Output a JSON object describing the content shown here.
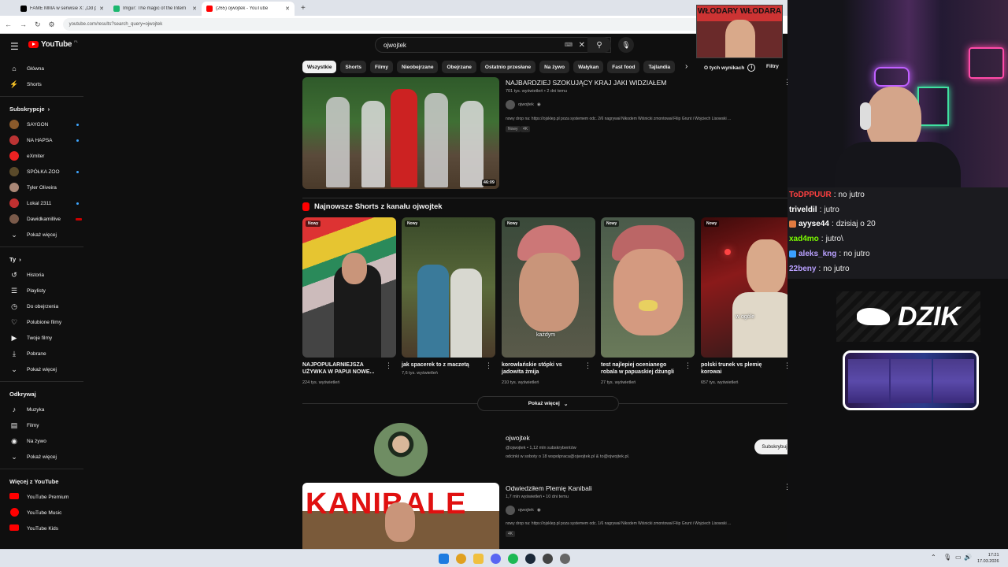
{
  "browser": {
    "tabs": [
      {
        "label": "FAME MMA w serwisie X: „Od p",
        "color": "#000000"
      },
      {
        "label": "Imgur: The magic of the Intern",
        "color": "#1bb76e"
      },
      {
        "label": "(265) ojwojtek - YouTube",
        "color": "#ff0000"
      }
    ],
    "new_tab": "+",
    "url": "youtube.com/results?search_query=ojwojtek"
  },
  "youtube": {
    "logo": "YouTube",
    "logo_region": "PL",
    "search_value": "ojwojtek",
    "sidebar": {
      "main": [
        {
          "label": "Główna",
          "icon": "home-icon"
        },
        {
          "label": "Shorts",
          "icon": "shorts-icon"
        }
      ],
      "subs_header": "Subskrypcje",
      "subs": [
        {
          "label": "SAYGON",
          "color": "#8b5a2b",
          "mark": "dot"
        },
        {
          "label": "NA HAPSA",
          "color": "#b33",
          "mark": "dot"
        },
        {
          "label": "eXmiter",
          "color": "#e22",
          "mark": ""
        },
        {
          "label": "SPÓŁKA ZOO",
          "color": "#5a4a2a",
          "mark": "dot"
        },
        {
          "label": "Tyler Oliveira",
          "color": "#aa8877",
          "mark": ""
        },
        {
          "label": "Lokal 2311",
          "color": "#c03030",
          "mark": "dot"
        },
        {
          "label": "Dawidkamillive",
          "color": "#7a5a4a",
          "mark": "live"
        }
      ],
      "subs_more": "Pokaż więcej",
      "you_header": "Ty",
      "you": [
        {
          "label": "Historia",
          "icon": "history-icon",
          "glyph": "↺"
        },
        {
          "label": "Playlisty",
          "icon": "playlist-icon",
          "glyph": "☰"
        },
        {
          "label": "Do obejrzenia",
          "icon": "watch-later-icon",
          "glyph": "◷"
        },
        {
          "label": "Polubione filmy",
          "icon": "like-icon",
          "glyph": "👍"
        },
        {
          "label": "Twoje filmy",
          "icon": "your-videos-icon",
          "glyph": "▶"
        },
        {
          "label": "Pobrane",
          "icon": "download-icon",
          "glyph": "⭳"
        },
        {
          "label": "Pokaż więcej",
          "icon": "chevron-down-icon",
          "glyph": "⌄"
        }
      ],
      "explore_header": "Odkrywaj",
      "explore": [
        {
          "label": "Muzyka",
          "icon": "music-icon",
          "glyph": "♪"
        },
        {
          "label": "Filmy",
          "icon": "film-icon",
          "glyph": "▤"
        },
        {
          "label": "Na żywo",
          "icon": "live-icon",
          "glyph": "◉"
        },
        {
          "label": "Pokaż więcej",
          "icon": "chevron-down-icon",
          "glyph": "⌄"
        }
      ],
      "more_header": "Więcej z YouTube",
      "more": [
        {
          "label": "YouTube Premium"
        },
        {
          "label": "YouTube Music"
        },
        {
          "label": "YouTube Kids"
        }
      ]
    },
    "chips": [
      "Wszystkie",
      "Shorts",
      "Filmy",
      "Nieobejrzane",
      "Obejrzane",
      "Ostatnio przesłane",
      "Na żywo",
      "Wałykan",
      "Fast food",
      "Tajlandia"
    ],
    "about": "O tych wynikach",
    "filters": "Filtry",
    "video1": {
      "title": "NAJBARDZIEJ SZOKUJĄCY KRAJ JAKI WIDZIAŁEM",
      "meta": "701 tys. wyświetleń • 2 dni temu",
      "channel": "ojwojtek",
      "desc": "nowy drop na: https://ojsklep.pl poza systemem odc. 2/6 nagrywał Nikodem Wiśnicki zmontował Filip Grunt i Wojciech Lisowski ...",
      "badges": [
        "Nowy",
        "4K"
      ],
      "duration": "46:09"
    },
    "shorts_header": "Najnowsze Shorts z kanału ojwojtek",
    "shorts": [
      {
        "new": "Nowy",
        "title": "NAJPOPULARNIEJSZA UŻYWKA W PAPUI NOWE...",
        "views": "224 tys. wyświetleń",
        "caption": ""
      },
      {
        "new": "Nowy",
        "title": "jak spacerek to z maczetą",
        "views": "7,6 tys. wyświetleń",
        "caption": ""
      },
      {
        "new": "Nowy",
        "title": "korowlańskie stópki vs jadowita żmija",
        "views": "210 tys. wyświetleń",
        "caption": "każdym"
      },
      {
        "new": "Nowy",
        "title": "test najlepiej ocenianego robala w papuaskiej dżungli",
        "views": "27 tys. wyświetleń",
        "caption": ""
      },
      {
        "new": "Nowy",
        "title": "polski trunek vs plemię korowai",
        "views": "657 tys. wyświetleń",
        "caption": "w ogóle"
      }
    ],
    "show_more": "Pokaż więcej",
    "channel_card": {
      "name": "ojwojtek",
      "meta": "@ojwojtek • 1,12 mln subskrybentów",
      "desc": "odcinki w soboty o 18 wspolpraca@ojwojtek.pl & to@ojwojtek.pl.",
      "subscribe": "Subskrybuj"
    },
    "video2": {
      "title": "Odwiedziłem Plemię Kanibali",
      "meta": "1,7 mln wyświetleń • 10 dni temu",
      "channel": "ojwojtek",
      "desc": "nowy drop na: https://ojsklep.pl poza systemem odc. 1/6 nagrywał Nikodem Wiśnicki zmontował Filip Grunt i Wojciech Lisowski ...",
      "badges": [
        "4K"
      ],
      "thumb_text": "KANIBALE"
    }
  },
  "stream": {
    "poster_text": "WŁODARY WŁODARA",
    "chat": [
      {
        "user": "ToDPPUUR",
        "color": "#ff4040",
        "msg": "no jutro"
      },
      {
        "user": "triveldil",
        "color": "#ffffff",
        "msg": "jutro"
      },
      {
        "user": "ayyse44",
        "color": "#ffffff",
        "msg": "dzisiaj o 20"
      },
      {
        "user": "xad4mo",
        "color": "#7cfc00",
        "msg": "jutro\\"
      },
      {
        "user": "aleks_kng",
        "color": "#b9a0ff",
        "msg": "no jutro"
      },
      {
        "user": "22beny",
        "color": "#b9a0ff",
        "msg": "no jutro"
      }
    ],
    "sponsor": "DZIK"
  },
  "taskbar": {
    "time": "17:21",
    "date": "17.03.2026"
  }
}
